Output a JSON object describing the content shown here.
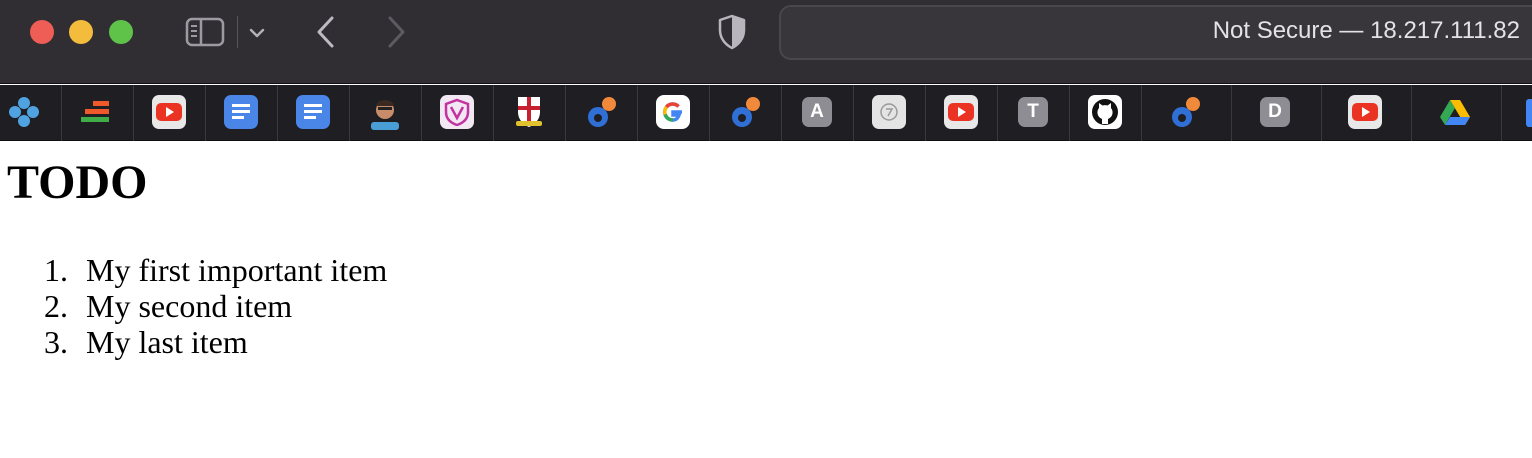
{
  "window": {
    "address": "Not Secure — 18.217.111.82"
  },
  "favorites": [
    {
      "icon": "app-icon"
    },
    {
      "icon": "stacked-bars-icon"
    },
    {
      "icon": "youtube-icon"
    },
    {
      "icon": "google-docs-icon"
    },
    {
      "icon": "google-docs-icon"
    },
    {
      "icon": "avatar-icon"
    },
    {
      "icon": "shield-v-icon"
    },
    {
      "icon": "crest-icon"
    },
    {
      "icon": "blue-orange-app-icon"
    },
    {
      "icon": "google-icon"
    },
    {
      "icon": "blue-orange-app-icon"
    },
    {
      "icon": "letter-tile-icon",
      "letter": "A"
    },
    {
      "icon": "circle-logo-icon"
    },
    {
      "icon": "youtube-icon"
    },
    {
      "icon": "letter-tile-icon",
      "letter": "T"
    },
    {
      "icon": "github-icon"
    },
    {
      "icon": "blue-orange-app-icon"
    },
    {
      "icon": "letter-tile-icon",
      "letter": "D"
    },
    {
      "icon": "youtube-icon"
    },
    {
      "icon": "google-drive-icon"
    }
  ],
  "page": {
    "title": "TODO",
    "items": [
      {
        "number": "1.",
        "text": "My first important item"
      },
      {
        "number": "2.",
        "text": "My second item"
      },
      {
        "number": "3.",
        "text": "My last item"
      }
    ]
  },
  "colors": {
    "toolbar": "#302e33",
    "favorites_bar": "#1f1e22",
    "close": "#ee5e56",
    "minimize": "#f4bc3c",
    "maximize": "#5fc34a"
  }
}
